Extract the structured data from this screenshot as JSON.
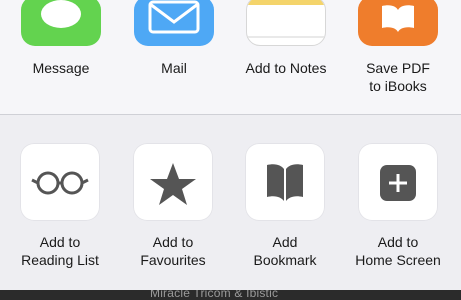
{
  "share_sheet": {
    "apps": [
      {
        "icon": "message-icon",
        "label_lines": [
          "Message"
        ]
      },
      {
        "icon": "mail-icon",
        "label_lines": [
          "Mail"
        ]
      },
      {
        "icon": "notes-icon",
        "label_lines": [
          "Add to Notes"
        ]
      },
      {
        "icon": "ibooks-icon",
        "label_lines": [
          "Save PDF",
          "to iBooks"
        ]
      }
    ],
    "actions": [
      {
        "icon": "glasses-icon",
        "label_lines": [
          "Add to",
          "Reading List"
        ]
      },
      {
        "icon": "star-icon",
        "label_lines": [
          "Add to",
          "Favourites"
        ]
      },
      {
        "icon": "book-icon",
        "label_lines": [
          "Add",
          "Bookmark"
        ]
      },
      {
        "icon": "add-square-icon",
        "label_lines": [
          "Add to",
          "Home Screen"
        ]
      }
    ]
  },
  "background_peek_text": "Miracle Tricom & Ibistic",
  "colors": {
    "message_green": "#63d34f",
    "mail_blue": "#4ea8f5",
    "ibooks_orange": "#ef7d2c",
    "action_glyph_dark": "#555555"
  }
}
